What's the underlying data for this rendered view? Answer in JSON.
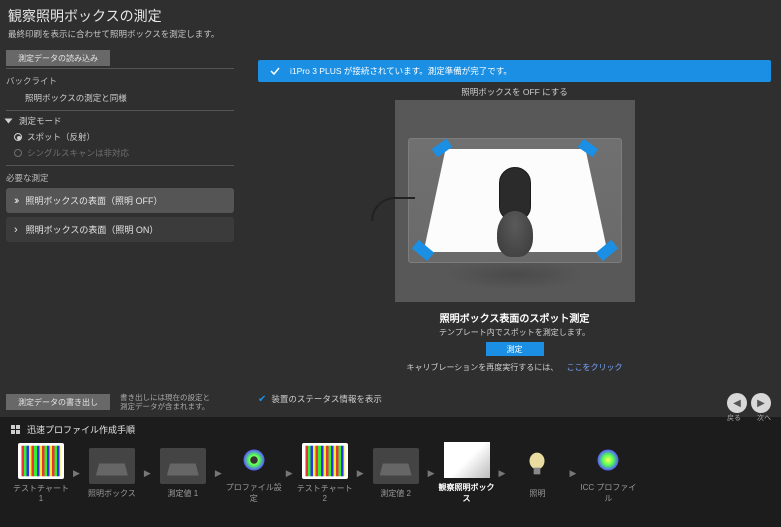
{
  "header": {
    "title": "観察照明ボックスの測定",
    "subtitle": "最終印刷を表示に合わせて照明ボックスを測定します。",
    "import_button": "測定データの読み込み"
  },
  "sidebar": {
    "backlight_head": "バックライト",
    "backlight_item": "照明ボックスの測定と同様",
    "mode_head": "測定モード",
    "mode_spot": "スポット（反射）",
    "mode_scan_disabled": "シングルスキャンは非対応",
    "required_head": "必要な測定",
    "steps": [
      {
        "label": "照明ボックスの表面（照明 OFF）"
      },
      {
        "label": "照明ボックスの表面（照明 ON）"
      }
    ]
  },
  "content": {
    "banner": "i1Pro 3 PLUS が接続されています。測定準備が完了です。",
    "off_link": "照明ボックスを OFF にする",
    "caption_title": "照明ボックス表面のスポット測定",
    "caption_sub": "テンプレート内でスポットを測定します。",
    "measure_button": "測定",
    "recal_text": "キャリブレーションを再度実行するには、",
    "recal_link": "ここをクリック",
    "status_checkbox": "装置のステータス情報を表示"
  },
  "export": {
    "button": "測定データの書き出し",
    "note1": "書き出しには現在の設定と",
    "note2": "測定データが含まれます。"
  },
  "footer": {
    "head": "迅速プロファイル作成手順",
    "back": "戻る",
    "next": "次へ",
    "steps": [
      {
        "label": "テストチャート 1"
      },
      {
        "label": "照明ボックス"
      },
      {
        "label": "測定値 1"
      },
      {
        "label": "プロファイル設定"
      },
      {
        "label": "テストチャート 2"
      },
      {
        "label": "測定値 2"
      },
      {
        "label": "観察照明ボックス"
      },
      {
        "label": "照明"
      },
      {
        "label": "ICC プロファイル"
      }
    ]
  }
}
